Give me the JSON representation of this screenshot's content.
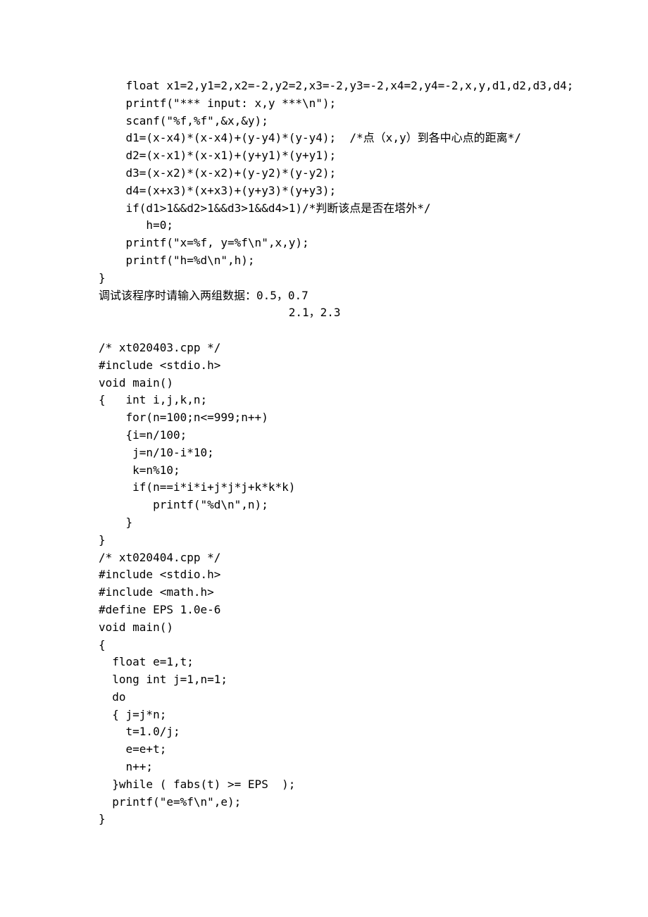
{
  "lines": [
    "    float x1=2,y1=2,x2=-2,y2=2,x3=-2,y3=-2,x4=2,y4=-2,x,y,d1,d2,d3,d4;",
    "    printf(\"*** input: x,y ***\\n\");",
    "    scanf(\"%f,%f\",&x,&y);",
    "    d1=(x-x4)*(x-x4)+(y-y4)*(y-y4);  /*点（x,y）到各中心点的距离*/",
    "    d2=(x-x1)*(x-x1)+(y+y1)*(y+y1);",
    "    d3=(x-x2)*(x-x2)+(y-y2)*(y-y2);",
    "    d4=(x+x3)*(x+x3)+(y+y3)*(y+y3);",
    "    if(d1>1&&d2>1&&d3>1&&d4>1)/*判断该点是否在塔外*/",
    "       h=0;",
    "    printf(\"x=%f, y=%f\\n\",x,y);",
    "    printf(\"h=%d\\n\",h);",
    "}",
    "调试该程序时请输入两组数据：0.5，0.7",
    "                            2.1，2.3",
    "",
    "/* xt020403.cpp */",
    "#include <stdio.h>",
    "void main()",
    "{   int i,j,k,n;",
    "    for(n=100;n<=999;n++)",
    "    {i=n/100;",
    "     j=n/10-i*10;",
    "     k=n%10;",
    "     if(n==i*i*i+j*j*j+k*k*k)",
    "        printf(\"%d\\n\",n);",
    "    }",
    "}",
    "/* xt020404.cpp */",
    "#include <stdio.h>",
    "#include <math.h>",
    "#define EPS 1.0e-6",
    "void main()",
    "{",
    "  float e=1,t;",
    "  long int j=1,n=1;",
    "  do",
    "  { j=j*n;",
    "    t=1.0/j;",
    "    e=e+t;",
    "    n++;",
    "  }while ( fabs(t) >= EPS  );",
    "  printf(\"e=%f\\n\",e);",
    "}"
  ]
}
